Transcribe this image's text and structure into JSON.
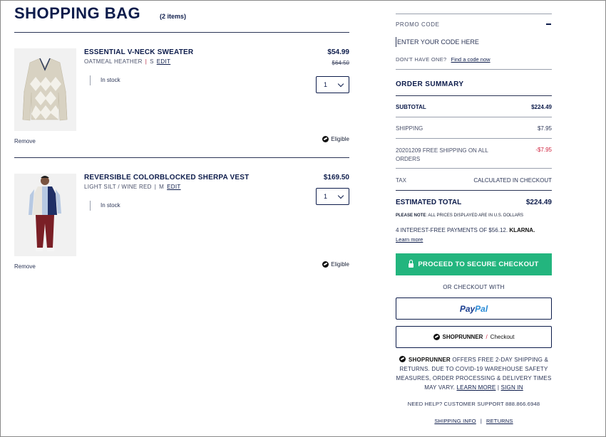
{
  "bag": {
    "title": "SHOPPING BAG",
    "count": "(2 items)"
  },
  "items": [
    {
      "name": "ESSENTIAL V-NECK SWEATER",
      "color": "OATMEAL HEATHER",
      "size": "S",
      "edit": "EDIT",
      "stock": "In stock",
      "price": "$54.99",
      "old_price": "$64.50",
      "qty": "1",
      "remove": "Remove",
      "eligible": "Eligible"
    },
    {
      "name": "REVERSIBLE COLORBLOCKED SHERPA VEST",
      "color": "LIGHT SILT / WINE RED",
      "size": "M",
      "edit": "EDIT",
      "stock": "In stock",
      "price": "$169.50",
      "qty": "1",
      "remove": "Remove",
      "eligible": "Eligible"
    }
  ],
  "promo": {
    "label": "PROMO CODE",
    "placeholder": "ENTER YOUR CODE HERE",
    "dont_have": "DON'T HAVE ONE?",
    "find_link": "Find a code now"
  },
  "summary": {
    "title": "ORDER SUMMARY",
    "subtotal_label": "SUBTOTAL",
    "subtotal_value": "$224.49",
    "shipping_label": "SHIPPING",
    "shipping_value": "$7.95",
    "promo_label": "20201209 FREE SHIPPING ON ALL ORDERS",
    "promo_value": "-$7.95",
    "tax_label": "TAX",
    "tax_value": "CALCULATED IN CHECKOUT",
    "total_label": "ESTIMATED TOTAL",
    "total_value": "$224.49",
    "note_bold": "PLEASE NOTE",
    "note_text": ": ALL PRICES DISPLAYED ARE IN U.S. DOLLARS",
    "klarna_text": "4 INTEREST-FREE PAYMENTS OF $56.12.",
    "klarna_brand": "KLARNA.",
    "learn_more": "Learn more"
  },
  "checkout": {
    "secure_label": "PROCEED TO SECURE CHECKOUT",
    "or_with": "OR CHECKOUT WITH",
    "paypal_a": "Pay",
    "paypal_b": "Pal",
    "shoprunner": "SHOPRUNNER",
    "slash": "/",
    "checkout_word": "Checkout"
  },
  "shoprunner_info": {
    "brand": "SHOPRUNNER",
    "text": "OFFERS FREE 2-DAY SHIPPING & RETURNS. DUE TO COVID-19 WAREHOUSE SAFETY MEASURES, ORDER PROCESSING & DELIVERY TIMES MAY VARY.",
    "learn_more": "LEARN MORE",
    "sep": "|",
    "sign_in": "SIGN IN"
  },
  "help": "NEED HELP? CUSTOMER SUPPORT 888.866.6948",
  "footer": {
    "shipping_info": "SHIPPING INFO",
    "sep": "|",
    "returns": "RETURNS"
  },
  "colors": {
    "navy": "#0d1c4b",
    "checkout_green": "#23b57e",
    "discount_red": "#d0233f"
  },
  "icons": [
    "lock-icon",
    "chevron-down-icon",
    "minus-icon",
    "shoprunner-icon",
    "sweater-image",
    "vest-model-image"
  ]
}
